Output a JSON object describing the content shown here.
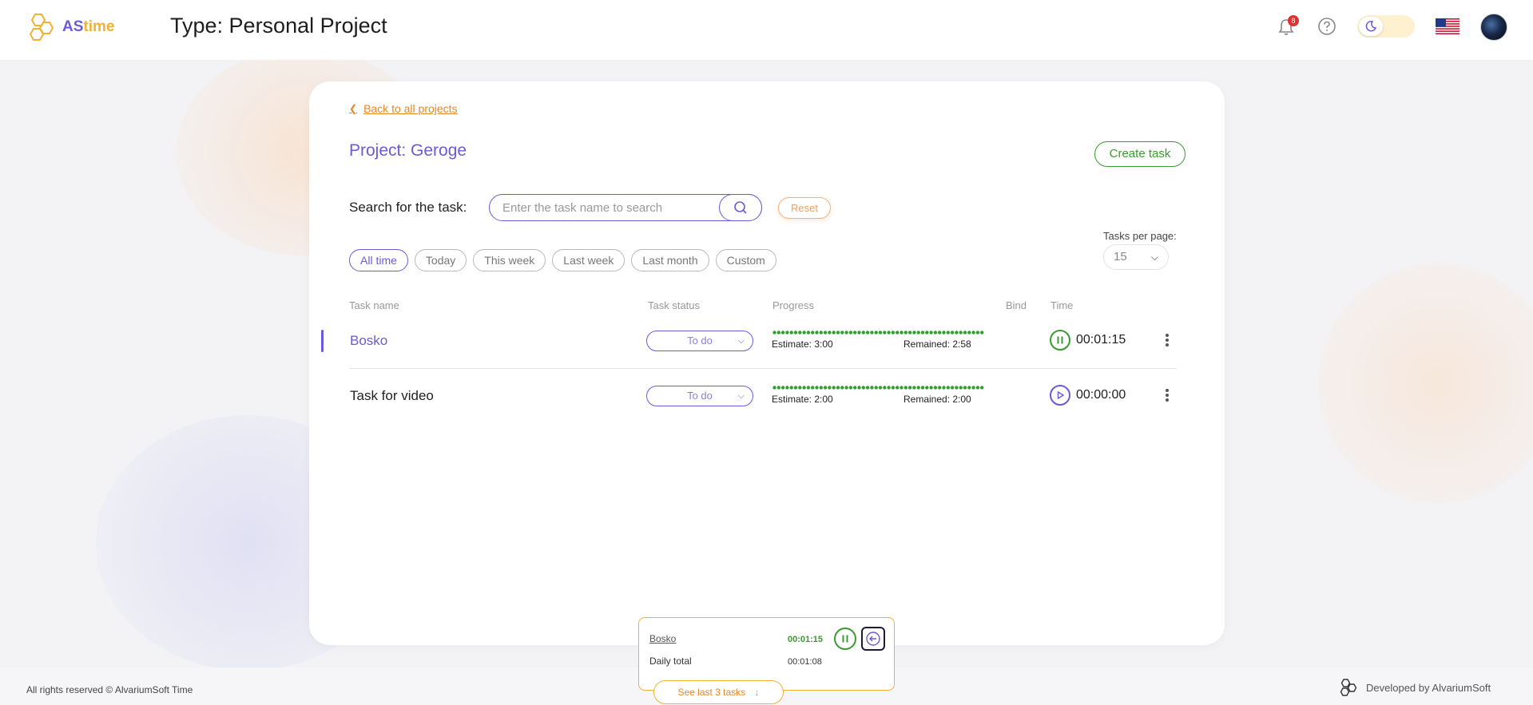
{
  "header": {
    "logo_as": "AS",
    "logo_time": "time",
    "page_type": "Type: Personal Project",
    "notifications_count": "8"
  },
  "page": {
    "back_link": "Back to all projects",
    "project_title": "Project: Geroge",
    "create_task": "Create task",
    "search_label": "Search for the task:",
    "search_placeholder": "Enter the task name to search",
    "search_value": "",
    "reset": "Reset",
    "filters": [
      "All time",
      "Today",
      "This week",
      "Last week",
      "Last month",
      "Custom"
    ],
    "active_filter": "All time",
    "tasks_per_page_label": "Tasks per page:",
    "tasks_per_page": "15"
  },
  "table": {
    "columns": {
      "name": "Task name",
      "status": "Task status",
      "progress": "Progress",
      "bind": "Bind",
      "time": "Time"
    },
    "rows": [
      {
        "name": "Bosko",
        "status": "To do",
        "estimate": "Estimate: 3:00",
        "remained": "Remained: 2:58",
        "time": "00:01:15",
        "running": true
      },
      {
        "name": "Task for video",
        "status": "To do",
        "estimate": "Estimate: 2:00",
        "remained": "Remained: 2:00",
        "time": "00:00:00",
        "running": false
      }
    ]
  },
  "tracker": {
    "task": "Bosko",
    "time": "00:01:15",
    "daily_label": "Daily total",
    "daily_value": "00:01:08",
    "see_last": "See last 3 tasks"
  },
  "footer": {
    "copyright": "All rights reserved © AlvariumSoft Time",
    "developed_by": "Developed by AlvariumSoft"
  },
  "colors": {
    "accent_purple": "#6a5bd6",
    "accent_orange": "#e6872a",
    "accent_green": "#3a9a2e",
    "accent_yellow": "#f2b134"
  },
  "icons": [
    "hexagon-logo-icon",
    "bell-icon",
    "help-icon",
    "moon-icon",
    "us-flag-icon",
    "avatar",
    "search-icon",
    "chevron-down-icon",
    "pause-icon",
    "play-icon",
    "kebab-menu-icon",
    "arrow-left-icon",
    "arrow-down-icon"
  ]
}
